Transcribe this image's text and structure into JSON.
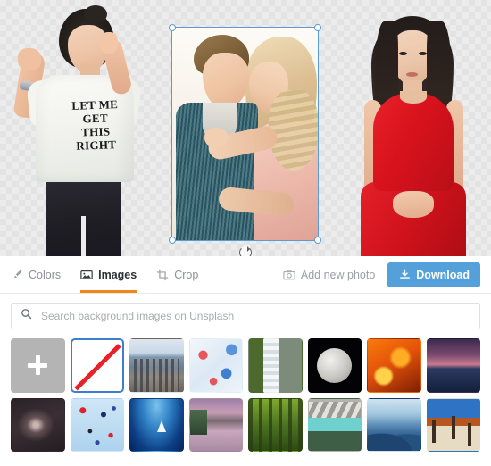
{
  "canvas": {
    "background_label": "transparent-checkerboard",
    "layers": [
      {
        "name": "woman-phone-photo",
        "selected": false,
        "tee_text_lines": [
          "LET ME",
          "GET",
          "THIS",
          "RIGHT"
        ]
      },
      {
        "name": "couple-photo",
        "selected": true
      },
      {
        "name": "woman-red-dress-photo",
        "selected": false
      }
    ],
    "selection": {
      "handles": [
        "top-left",
        "top-right",
        "bottom-left",
        "bottom-right"
      ],
      "rotate_icon": "rotate-icon",
      "border_color": "#5b9bd5"
    }
  },
  "toolbar": {
    "tabs": [
      {
        "id": "colors",
        "label": "Colors",
        "icon": "brush-icon",
        "active": false
      },
      {
        "id": "images",
        "label": "Images",
        "icon": "image-icon",
        "active": true
      },
      {
        "id": "crop",
        "label": "Crop",
        "icon": "crop-icon",
        "active": false
      }
    ],
    "add_photo": {
      "label": "Add new photo",
      "icon": "camera-icon"
    },
    "download": {
      "label": "Download",
      "icon": "download-icon",
      "color": "#54a0db"
    },
    "active_tab_underline_color": "#f0871a"
  },
  "search": {
    "placeholder": "Search background images on Unsplash",
    "value": "",
    "icon": "search-icon"
  },
  "thumbnails": {
    "items": [
      {
        "id": "add",
        "kind": "add",
        "label": "Add image",
        "art": "",
        "selected": false
      },
      {
        "id": "none",
        "kind": "none",
        "label": "No background",
        "art": "",
        "selected": true
      },
      {
        "id": "city",
        "kind": "image",
        "label": "City skyline",
        "art": "t-city",
        "selected": false
      },
      {
        "id": "marble",
        "kind": "image",
        "label": "Red blue marble",
        "art": "t-marble",
        "selected": false
      },
      {
        "id": "waterfall",
        "kind": "image",
        "label": "Waterfall",
        "art": "t-waterfall",
        "selected": false
      },
      {
        "id": "moon",
        "kind": "image",
        "label": "Full moon",
        "art": "t-moon",
        "selected": false
      },
      {
        "id": "fire",
        "kind": "image",
        "label": "Fire flames",
        "art": "t-fire",
        "selected": false
      },
      {
        "id": "dusk",
        "kind": "image",
        "label": "Purple dusk sky",
        "art": "t-dusk",
        "selected": false
      },
      {
        "id": "galaxy",
        "kind": "image",
        "label": "Milky way galaxy",
        "art": "t-galaxy",
        "selected": false
      },
      {
        "id": "confetti",
        "kind": "image",
        "label": "Beach umbrellas",
        "art": "t-confetti",
        "selected": false
      },
      {
        "id": "ocean",
        "kind": "image",
        "label": "Deep blue ocean",
        "art": "t-ocean",
        "selected": false
      },
      {
        "id": "canal",
        "kind": "image",
        "label": "Venice canal",
        "art": "t-canal",
        "selected": false
      },
      {
        "id": "forest",
        "kind": "image",
        "label": "Green forest",
        "art": "t-forest",
        "selected": false
      },
      {
        "id": "lake",
        "kind": "image",
        "label": "Turquoise lake",
        "art": "t-lake",
        "selected": false
      },
      {
        "id": "mountains",
        "kind": "image",
        "label": "Blue mountain ridges",
        "art": "t-mountains",
        "selected": false
      },
      {
        "id": "desert",
        "kind": "image",
        "label": "Desert dead trees",
        "art": "t-desert",
        "selected": false
      }
    ]
  }
}
